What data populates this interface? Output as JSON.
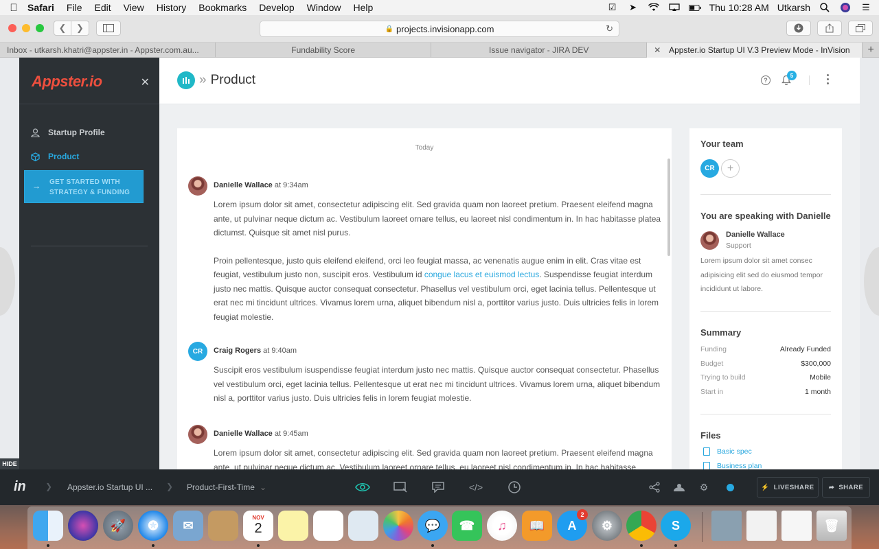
{
  "menubar": {
    "app": "Safari",
    "items": [
      "File",
      "Edit",
      "View",
      "History",
      "Bookmarks",
      "Develop",
      "Window",
      "Help"
    ],
    "clock": "Thu 10:28 AM",
    "user": "Utkarsh"
  },
  "browser": {
    "url": "projects.invisionapp.com",
    "tabs": [
      {
        "title": "Inbox - utkarsh.khatri@appster.in - Appster.com.au..."
      },
      {
        "title": "Fundability Score"
      },
      {
        "title": "Issue navigator - JIRA DEV"
      },
      {
        "title": "Appster.io Startup UI V.3 Preview Mode - InVision"
      }
    ]
  },
  "sidebar": {
    "logo": "Appster.io",
    "items": [
      {
        "label": "Startup Profile",
        "icon": "user-icon"
      },
      {
        "label": "Product",
        "icon": "cube-icon"
      }
    ],
    "cta": "GET STARTED WITH STRATEGY & FUNDING",
    "hide_label": "HIDE"
  },
  "header": {
    "crumb_sep": "»",
    "title": "Product",
    "notification_count": "5"
  },
  "chat": {
    "day_label": "Today",
    "messages": [
      {
        "author": "Danielle Wallace",
        "time": "at 9:34am",
        "para1": "Lorem ipsum dolor sit amet, consectetur adipiscing elit. Sed gravida quam non laoreet pretium. Praesent eleifend magna ante, ut pulvinar neque dictum ac. Vestibulum laoreet ornare tellus, eu laoreet nisl condimentum in. In hac habitasse platea dictumst. Quisque sit amet nisl purus.",
        "para2_before": "Proin pellentesque, justo quis eleifend eleifend, orci leo feugiat massa, ac venenatis augue enim in elit. Cras vitae est feugiat, vestibulum justo non, suscipit eros. Vestibulum id ",
        "para2_link": "congue lacus et euismod lectus",
        "para2_after": ". Suspendisse feugiat interdum justo nec mattis. Quisque auctor consequat consectetur. Phasellus vel vestibulum orci, eget lacinia tellus. Pellentesque ut erat nec mi tincidunt ultrices. Vivamus lorem urna, aliquet bibendum nisl a, porttitor varius justo. Duis ultricies felis in lorem feugiat molestie."
      },
      {
        "author": "Craig Rogers",
        "initials": "CR",
        "time": "at 9:40am",
        "para1": "Suscipit eros vestibulum isuspendisse feugiat interdum justo nec mattis. Quisque auctor consequat consectetur. Phasellus vel vestibulum orci, eget lacinia tellus. Pellentesque ut erat nec mi tincidunt ultrices. Vivamus lorem urna, aliquet bibendum nisl a, porttitor varius justo. Duis ultricies felis in lorem feugiat molestie."
      },
      {
        "author": "Danielle Wallace",
        "time": "at 9:45am",
        "para1": "Lorem ipsum dolor sit amet, consectetur adipiscing elit. Sed gravida quam non laoreet pretium. Praesent eleifend magna ante, ut pulvinar neque dictum ac. Vestibulum laoreet ornare tellus, eu laoreet nisl condimentum in. In hac habitasse"
      }
    ]
  },
  "rightpanel": {
    "team_heading": "Your team",
    "team_initials": "CR",
    "team_add": "+",
    "speaking_heading": "You are speaking with Danielle",
    "agent_name": "Danielle Wallace",
    "agent_role": "Support",
    "agent_bio": "Lorem ipsum dolor sit amet consec adipisicing elit sed do eiusmod tempor incididunt ut labore.",
    "summary_heading": "Summary",
    "summary": [
      {
        "key": "Funding",
        "value": "Already Funded"
      },
      {
        "key": "Budget",
        "value": "$300,000"
      },
      {
        "key": "Trying to build",
        "value": "Mobile"
      },
      {
        "key": "Start in",
        "value": "1 month"
      }
    ],
    "files_heading": "Files",
    "files": [
      "Basic spec",
      "Business plan"
    ]
  },
  "invision": {
    "logo": "in",
    "project": "Appster.io Startup UI ...",
    "screen": "Product-First-Time",
    "liveshare": "LIVESHARE",
    "share": "SHARE"
  },
  "dock": {
    "calendar_month": "NOV",
    "calendar_day": "2",
    "appstore_badge": "2"
  },
  "colors": {
    "accent": "#28a9e0",
    "logo": "#ee4f3e",
    "sidebar_bg": "#2c3135",
    "invision_bar": "#23282c"
  }
}
